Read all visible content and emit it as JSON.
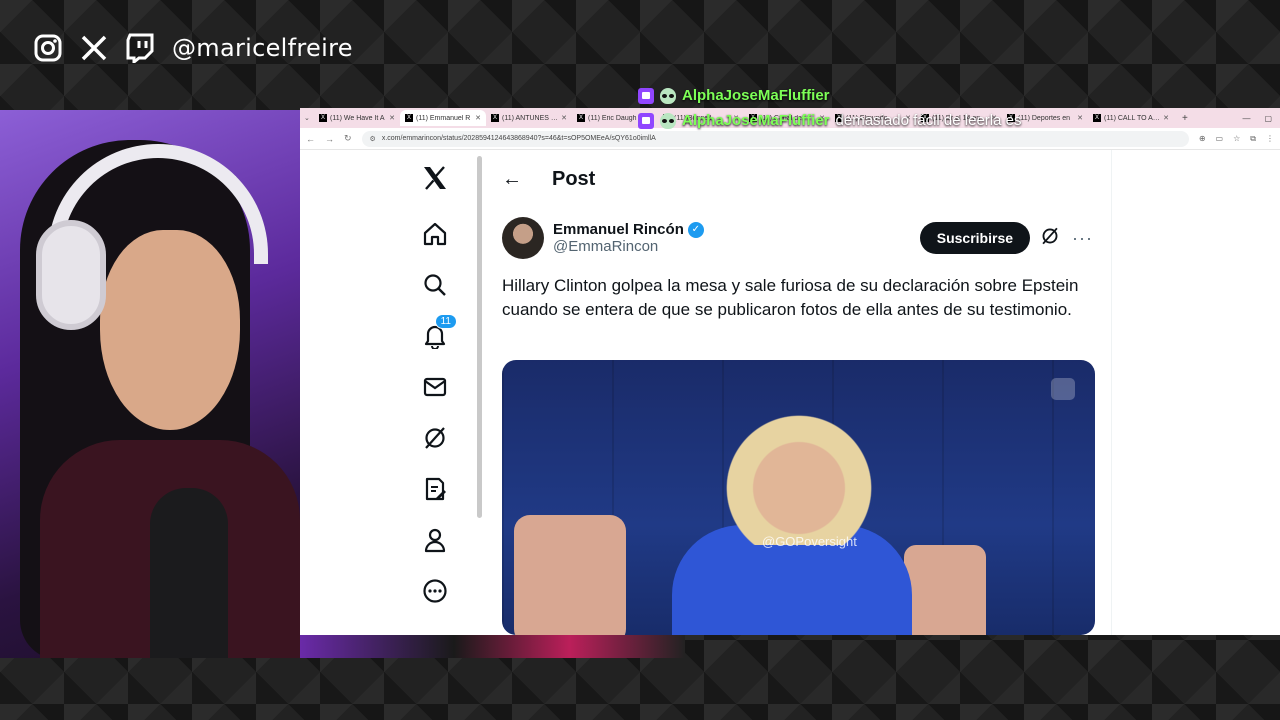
{
  "overlay": {
    "handle": "@maricelfreire",
    "social_icons": [
      "instagram-icon",
      "x-icon",
      "twitch-icon"
    ],
    "chat": [
      {
        "user": "AlphaJoseMaFluffier",
        "message": ""
      },
      {
        "user": "AlphaJoseMaFluffier",
        "message": "demasiado fácil de leerla es"
      }
    ]
  },
  "browser": {
    "tabs": [
      {
        "label": "(11) We Have It A"
      },
      {
        "label": "(11) Emmanuel R",
        "active": true
      },
      {
        "label": "(11) ANTUNES en"
      },
      {
        "label": "(11) Eric Daugh"
      },
      {
        "label": "(11) Bonnell"
      },
      {
        "label": "(11) Canal de"
      },
      {
        "label": "(11) Elmundo"
      },
      {
        "label": "(11) Dr el 14 en"
      },
      {
        "label": "(11) Deportes en"
      },
      {
        "label": "(11) CALL TO ACT"
      }
    ],
    "url": "x.com/emmarincon/status/2028594124643868940?s=46&t=sOP5OMEeA/sQY61o0imllA"
  },
  "x": {
    "notifications_count": "11",
    "header_title": "Post",
    "author": {
      "name": "Emmanuel Rincón",
      "handle": "@EmmaRincon"
    },
    "subscribe_label": "Suscribirse",
    "tweet_text": "Hillary Clinton golpea la mesa y sale furiosa de su declaración sobre Epstein cuando se entera de que se publicaron fotos de ella antes de su testimonio.",
    "media_watermark": "@GOPoversight"
  },
  "colors": {
    "x_blue": "#1d9bf0",
    "chat_name": "#7dff57",
    "twitch": "#9146ff"
  }
}
